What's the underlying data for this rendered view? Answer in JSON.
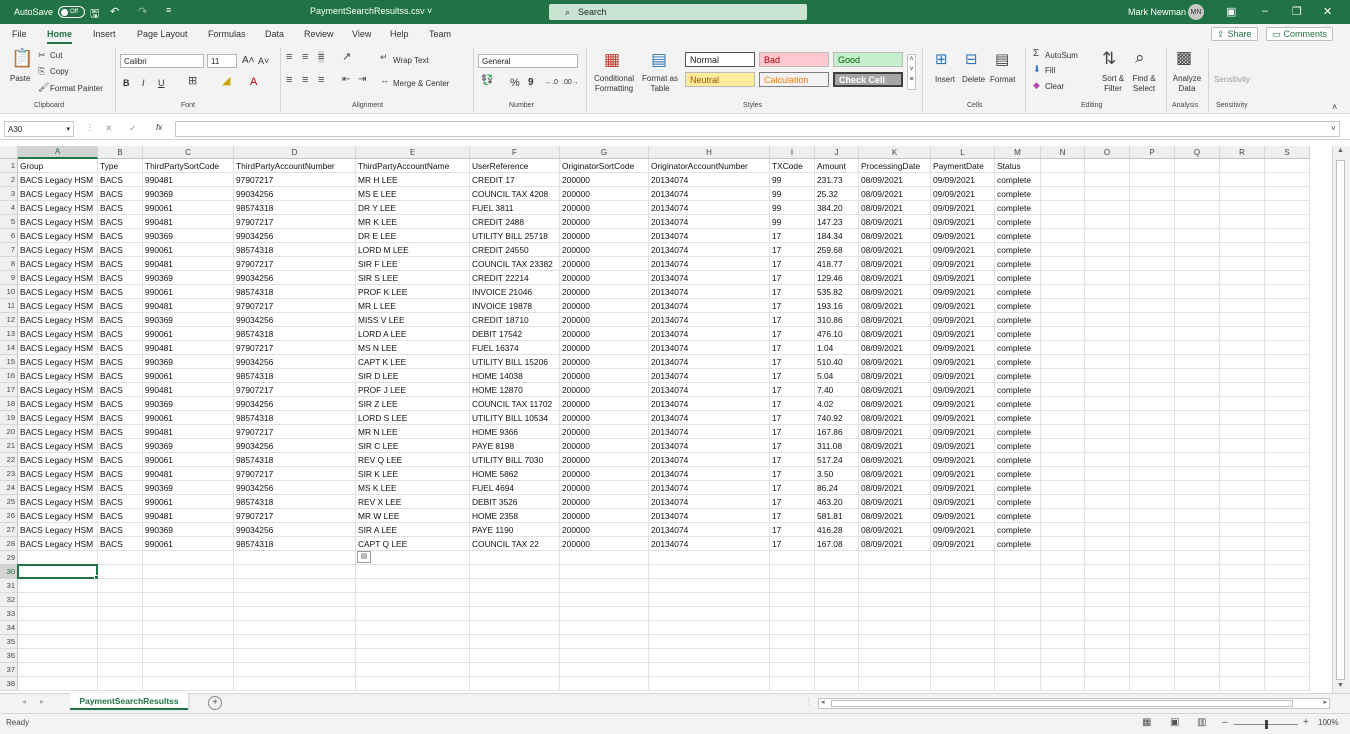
{
  "titlebar": {
    "autosave_label": "AutoSave",
    "autosave_state": "Off",
    "doc_title": "PaymentSearchResultss.csv ˅",
    "search_label": "Search",
    "user_name": "Mark Newman",
    "user_initials": "MN"
  },
  "menu": {
    "tabs": [
      "File",
      "Home",
      "Insert",
      "Page Layout",
      "Formulas",
      "Data",
      "Review",
      "View",
      "Help",
      "Team"
    ],
    "active": "Home",
    "share_label": "Share",
    "comments_label": "Comments"
  },
  "ribbon": {
    "clipboard": {
      "paste": "Paste",
      "cut": "Cut",
      "copy": "Copy",
      "format_painter": "Format Painter",
      "label": "Clipboard"
    },
    "font": {
      "name": "Calibri",
      "size": "11",
      "label": "Font",
      "bold": "B",
      "italic": "I",
      "underline": "U"
    },
    "alignment": {
      "wrap": "Wrap Text",
      "merge": "Merge & Center",
      "label": "Alignment"
    },
    "number": {
      "format": "General",
      "label": "Number",
      "percent": "%",
      "comma": "9"
    },
    "styles": {
      "conditional": "Conditional Formatting",
      "format_as_table": "Format as Table",
      "normal": "Normal",
      "bad": "Bad",
      "good": "Good",
      "neutral": "Neutral",
      "calculation": "Calculation",
      "check_cell": "Check Cell",
      "label": "Styles"
    },
    "cells": {
      "insert": "Insert",
      "delete": "Delete",
      "format": "Format",
      "label": "Cells"
    },
    "editing": {
      "autosum": "AutoSum",
      "fill": "Fill",
      "clear": "Clear",
      "sort": "Sort & Filter",
      "find": "Find & Select",
      "label": "Editing"
    },
    "analysis": {
      "analyze": "Analyze Data",
      "label": "Analysis"
    },
    "sensitivity": {
      "button": "Sensitivity",
      "label": "Sensitivity"
    }
  },
  "formula_bar": {
    "name_box": "A30",
    "fx": "fx",
    "content": ""
  },
  "grid": {
    "columns": [
      "A",
      "B",
      "C",
      "D",
      "E",
      "F",
      "G",
      "H",
      "I",
      "J",
      "K",
      "L",
      "M",
      "N",
      "O",
      "P",
      "Q",
      "R",
      "S"
    ],
    "selected_column": "A",
    "selected_row": 30,
    "total_rows": 38,
    "headers": [
      "Group",
      "Type",
      "ThirdPartySortCode",
      "ThirdPartyAccountNumber",
      "ThirdPartyAccountName",
      "UserReference",
      "OriginatorSortCode",
      "OriginatorAccountNumber",
      "TXCode",
      "Amount",
      "ProcessingDate",
      "PaymentDate",
      "Status"
    ],
    "rows": [
      [
        "BACS Legacy HSM",
        "BACS",
        "990481",
        "97907217",
        "MR H LEE",
        "CREDIT 17",
        "200000",
        "20134074",
        "99",
        "231.73",
        "08/09/2021",
        "09/09/2021",
        "complete"
      ],
      [
        "BACS Legacy HSM",
        "BACS",
        "990369",
        "99034256",
        "MS E LEE",
        "COUNCIL TAX 4208",
        "200000",
        "20134074",
        "99",
        "25.32",
        "08/09/2021",
        "09/09/2021",
        "complete"
      ],
      [
        "BACS Legacy HSM",
        "BACS",
        "990061",
        "98574318",
        "DR Y LEE",
        "FUEL 3811",
        "200000",
        "20134074",
        "99",
        "384.20",
        "08/09/2021",
        "09/09/2021",
        "complete"
      ],
      [
        "BACS Legacy HSM",
        "BACS",
        "990481",
        "97907217",
        "MR K LEE",
        "CREDIT 2488",
        "200000",
        "20134074",
        "99",
        "147.23",
        "08/09/2021",
        "09/09/2021",
        "complete"
      ],
      [
        "BACS Legacy HSM",
        "BACS",
        "990369",
        "99034256",
        "DR E LEE",
        "UTILITY BILL 25718",
        "200000",
        "20134074",
        "17",
        "184.34",
        "08/09/2021",
        "09/09/2021",
        "complete"
      ],
      [
        "BACS Legacy HSM",
        "BACS",
        "990061",
        "98574318",
        "LORD M LEE",
        "CREDIT 24550",
        "200000",
        "20134074",
        "17",
        "259.68",
        "08/09/2021",
        "09/09/2021",
        "complete"
      ],
      [
        "BACS Legacy HSM",
        "BACS",
        "990481",
        "97907217",
        "SIR F LEE",
        "COUNCIL TAX 23382",
        "200000",
        "20134074",
        "17",
        "418.77",
        "08/09/2021",
        "09/09/2021",
        "complete"
      ],
      [
        "BACS Legacy HSM",
        "BACS",
        "990369",
        "99034256",
        "SIR S LEE",
        "CREDIT 22214",
        "200000",
        "20134074",
        "17",
        "129.46",
        "08/09/2021",
        "09/09/2021",
        "complete"
      ],
      [
        "BACS Legacy HSM",
        "BACS",
        "990061",
        "98574318",
        "PROF K LEE",
        "INVOICE 21046",
        "200000",
        "20134074",
        "17",
        "535.82",
        "08/09/2021",
        "09/09/2021",
        "complete"
      ],
      [
        "BACS Legacy HSM",
        "BACS",
        "990481",
        "97907217",
        "MR L LEE",
        "INVOICE 19878",
        "200000",
        "20134074",
        "17",
        "193.16",
        "08/09/2021",
        "09/09/2021",
        "complete"
      ],
      [
        "BACS Legacy HSM",
        "BACS",
        "990369",
        "99034256",
        "MISS V LEE",
        "CREDIT 18710",
        "200000",
        "20134074",
        "17",
        "310.86",
        "08/09/2021",
        "09/09/2021",
        "complete"
      ],
      [
        "BACS Legacy HSM",
        "BACS",
        "990061",
        "98574318",
        "LORD A LEE",
        "DEBIT 17542",
        "200000",
        "20134074",
        "17",
        "476.10",
        "08/09/2021",
        "09/09/2021",
        "complete"
      ],
      [
        "BACS Legacy HSM",
        "BACS",
        "990481",
        "97907217",
        "MS N LEE",
        "FUEL 16374",
        "200000",
        "20134074",
        "17",
        "1.04",
        "08/09/2021",
        "09/09/2021",
        "complete"
      ],
      [
        "BACS Legacy HSM",
        "BACS",
        "990369",
        "99034256",
        "CAPT K LEE",
        "UTILITY BILL 15206",
        "200000",
        "20134074",
        "17",
        "510.40",
        "08/09/2021",
        "09/09/2021",
        "complete"
      ],
      [
        "BACS Legacy HSM",
        "BACS",
        "990061",
        "98574318",
        "SIR D LEE",
        "HOME 14038",
        "200000",
        "20134074",
        "17",
        "5.04",
        "08/09/2021",
        "09/09/2021",
        "complete"
      ],
      [
        "BACS Legacy HSM",
        "BACS",
        "990481",
        "97907217",
        "PROF J LEE",
        "HOME 12870",
        "200000",
        "20134074",
        "17",
        "7.40",
        "08/09/2021",
        "09/09/2021",
        "complete"
      ],
      [
        "BACS Legacy HSM",
        "BACS",
        "990369",
        "99034256",
        "SIR Z LEE",
        "COUNCIL TAX 11702",
        "200000",
        "20134074",
        "17",
        "4.02",
        "08/09/2021",
        "09/09/2021",
        "complete"
      ],
      [
        "BACS Legacy HSM",
        "BACS",
        "990061",
        "98574318",
        "LORD S LEE",
        "UTILITY BILL 10534",
        "200000",
        "20134074",
        "17",
        "740.92",
        "08/09/2021",
        "09/09/2021",
        "complete"
      ],
      [
        "BACS Legacy HSM",
        "BACS",
        "990481",
        "97907217",
        "MR N LEE",
        "HOME 9366",
        "200000",
        "20134074",
        "17",
        "167.86",
        "08/09/2021",
        "09/09/2021",
        "complete"
      ],
      [
        "BACS Legacy HSM",
        "BACS",
        "990369",
        "99034256",
        "SIR C LEE",
        "PAYE 8198",
        "200000",
        "20134074",
        "17",
        "311.08",
        "08/09/2021",
        "09/09/2021",
        "complete"
      ],
      [
        "BACS Legacy HSM",
        "BACS",
        "990061",
        "98574318",
        "REV Q LEE",
        "UTILITY BILL 7030",
        "200000",
        "20134074",
        "17",
        "517.24",
        "08/09/2021",
        "09/09/2021",
        "complete"
      ],
      [
        "BACS Legacy HSM",
        "BACS",
        "990481",
        "97907217",
        "SIR K LEE",
        "HOME 5862",
        "200000",
        "20134074",
        "17",
        "3.50",
        "08/09/2021",
        "09/09/2021",
        "complete"
      ],
      [
        "BACS Legacy HSM",
        "BACS",
        "990369",
        "99034256",
        "MS K LEE",
        "FUEL 4694",
        "200000",
        "20134074",
        "17",
        "86.24",
        "08/09/2021",
        "09/09/2021",
        "complete"
      ],
      [
        "BACS Legacy HSM",
        "BACS",
        "990061",
        "98574318",
        "REV X LEE",
        "DEBIT 3526",
        "200000",
        "20134074",
        "17",
        "463.20",
        "08/09/2021",
        "09/09/2021",
        "complete"
      ],
      [
        "BACS Legacy HSM",
        "BACS",
        "990481",
        "97907217",
        "MR W LEE",
        "HOME 2358",
        "200000",
        "20134074",
        "17",
        "581.81",
        "08/09/2021",
        "09/09/2021",
        "complete"
      ],
      [
        "BACS Legacy HSM",
        "BACS",
        "990369",
        "99034256",
        "SIR A LEE",
        "PAYE 1190",
        "200000",
        "20134074",
        "17",
        "416.28",
        "08/09/2021",
        "09/09/2021",
        "complete"
      ],
      [
        "BACS Legacy HSM",
        "BACS",
        "990061",
        "98574318",
        "CAPT Q LEE",
        "COUNCIL TAX 22",
        "200000",
        "20134074",
        "17",
        "167.08",
        "08/09/2021",
        "09/09/2021",
        "complete"
      ]
    ]
  },
  "sheet": {
    "tab_name": "PaymentSearchResultss",
    "add_label": "+"
  },
  "status": {
    "text": "Ready",
    "zoom": "100%"
  },
  "colors": {
    "accent": "#217346",
    "bad_bg": "#ffc7ce",
    "bad_fg": "#9c0006",
    "good_bg": "#c6efce",
    "good_fg": "#006100",
    "neutral_bg": "#ffeb9c",
    "neutral_fg": "#9c5700",
    "calc_bg": "#f2f2f2",
    "calc_fg": "#fa7d00",
    "check_bg": "#a5a5a5"
  }
}
